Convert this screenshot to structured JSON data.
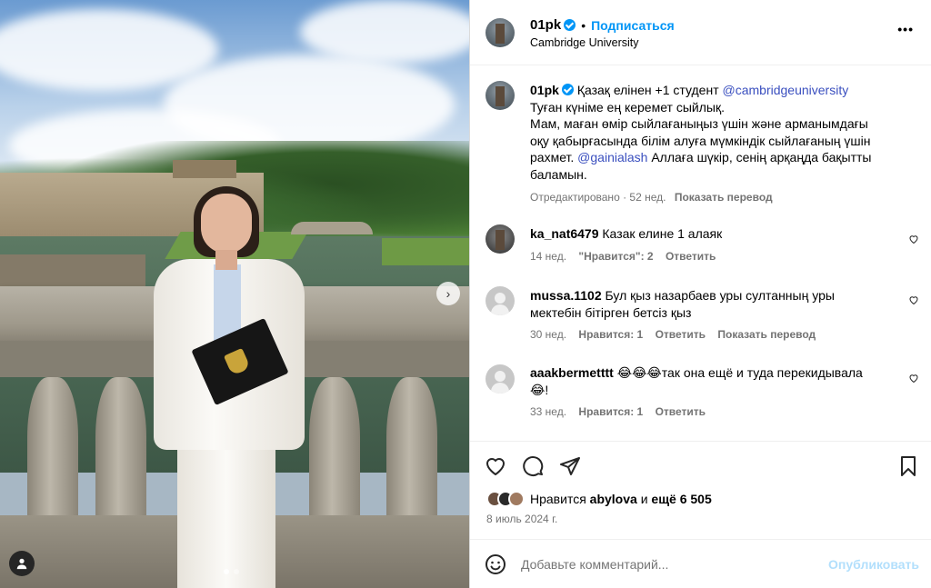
{
  "post": {
    "username": "01pk",
    "follow_label": "Подписаться",
    "location": "Cambridge University",
    "more_label": "•••",
    "caption": {
      "line1_text": "Қазақ елінен +1 студент",
      "line1_mention": "@cambridgeuniversity",
      "line2": "Туған күніме ең керемет сыйлық.",
      "line3": "Мам, маған өмір сыйлағаныңыз үшін және арманымдағы",
      "line4": "оқу қабырғасында білім алуға мүмкіндік сыйлағаның үшін",
      "line5_text": "рахмет.",
      "line5_mention": "@gainialash",
      "line5_rest": "Аллаға шүкір, сенің арқаңда бақытты",
      "line6": "баламын.",
      "edited": "Отредактировано",
      "time": "52 нед.",
      "translate": "Показать перевод"
    }
  },
  "comments": [
    {
      "username": "ka_nat6479",
      "text": "Казак елине 1 алаяк",
      "time": "14 нед.",
      "likes": "\"Нравится\": 2",
      "reply": "Ответить"
    },
    {
      "username": "mussa.1102",
      "text_line1": "Бул қыз назарбаев уры султанның уры",
      "text_line2": "мектебін бітірген бетсіз қыз",
      "time": "30 нед.",
      "likes": "Нравится: 1",
      "reply": "Ответить",
      "translate": "Показать перевод"
    },
    {
      "username": "aaakbermetttt",
      "emoji": "😂😂😂",
      "text_line1": "так она ещё и туда перекидывала",
      "text_line2": "😂!",
      "time": "33 нед.",
      "likes": "Нравится: 1",
      "reply": "Ответить"
    }
  ],
  "likes": {
    "prefix": "Нравится",
    "user": "abylova",
    "mid": "и",
    "others": "ещё 6 505"
  },
  "date": "8 июль 2024 г.",
  "add_comment": {
    "placeholder": "Добавьте комментарий...",
    "publish": "Опубликовать"
  },
  "icons": {
    "like": "heart-icon",
    "comment": "comment-icon",
    "share": "share-icon",
    "save": "bookmark-icon",
    "emoji": "emoji-icon",
    "more": "more-icon",
    "next": "chevron-right-icon",
    "tag": "user-tag-icon"
  },
  "colors": {
    "accent": "#0095f6",
    "mention": "#3a4fbf",
    "muted": "#737373"
  }
}
